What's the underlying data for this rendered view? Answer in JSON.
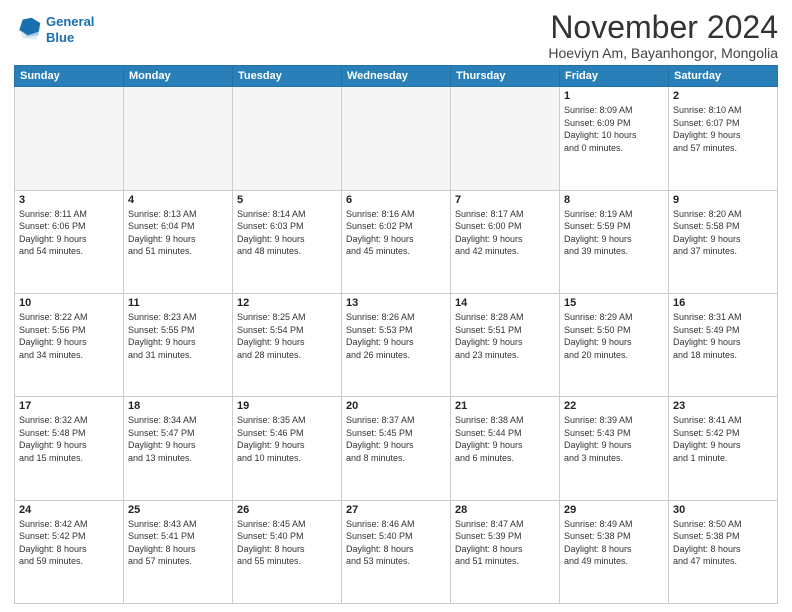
{
  "header": {
    "logo_line1": "General",
    "logo_line2": "Blue",
    "month": "November 2024",
    "location": "Hoeviyn Am, Bayanhongor, Mongolia"
  },
  "weekdays": [
    "Sunday",
    "Monday",
    "Tuesday",
    "Wednesday",
    "Thursday",
    "Friday",
    "Saturday"
  ],
  "weeks": [
    [
      {
        "day": "",
        "info": ""
      },
      {
        "day": "",
        "info": ""
      },
      {
        "day": "",
        "info": ""
      },
      {
        "day": "",
        "info": ""
      },
      {
        "day": "",
        "info": ""
      },
      {
        "day": "1",
        "info": "Sunrise: 8:09 AM\nSunset: 6:09 PM\nDaylight: 10 hours\nand 0 minutes."
      },
      {
        "day": "2",
        "info": "Sunrise: 8:10 AM\nSunset: 6:07 PM\nDaylight: 9 hours\nand 57 minutes."
      }
    ],
    [
      {
        "day": "3",
        "info": "Sunrise: 8:11 AM\nSunset: 6:06 PM\nDaylight: 9 hours\nand 54 minutes."
      },
      {
        "day": "4",
        "info": "Sunrise: 8:13 AM\nSunset: 6:04 PM\nDaylight: 9 hours\nand 51 minutes."
      },
      {
        "day": "5",
        "info": "Sunrise: 8:14 AM\nSunset: 6:03 PM\nDaylight: 9 hours\nand 48 minutes."
      },
      {
        "day": "6",
        "info": "Sunrise: 8:16 AM\nSunset: 6:02 PM\nDaylight: 9 hours\nand 45 minutes."
      },
      {
        "day": "7",
        "info": "Sunrise: 8:17 AM\nSunset: 6:00 PM\nDaylight: 9 hours\nand 42 minutes."
      },
      {
        "day": "8",
        "info": "Sunrise: 8:19 AM\nSunset: 5:59 PM\nDaylight: 9 hours\nand 39 minutes."
      },
      {
        "day": "9",
        "info": "Sunrise: 8:20 AM\nSunset: 5:58 PM\nDaylight: 9 hours\nand 37 minutes."
      }
    ],
    [
      {
        "day": "10",
        "info": "Sunrise: 8:22 AM\nSunset: 5:56 PM\nDaylight: 9 hours\nand 34 minutes."
      },
      {
        "day": "11",
        "info": "Sunrise: 8:23 AM\nSunset: 5:55 PM\nDaylight: 9 hours\nand 31 minutes."
      },
      {
        "day": "12",
        "info": "Sunrise: 8:25 AM\nSunset: 5:54 PM\nDaylight: 9 hours\nand 28 minutes."
      },
      {
        "day": "13",
        "info": "Sunrise: 8:26 AM\nSunset: 5:53 PM\nDaylight: 9 hours\nand 26 minutes."
      },
      {
        "day": "14",
        "info": "Sunrise: 8:28 AM\nSunset: 5:51 PM\nDaylight: 9 hours\nand 23 minutes."
      },
      {
        "day": "15",
        "info": "Sunrise: 8:29 AM\nSunset: 5:50 PM\nDaylight: 9 hours\nand 20 minutes."
      },
      {
        "day": "16",
        "info": "Sunrise: 8:31 AM\nSunset: 5:49 PM\nDaylight: 9 hours\nand 18 minutes."
      }
    ],
    [
      {
        "day": "17",
        "info": "Sunrise: 8:32 AM\nSunset: 5:48 PM\nDaylight: 9 hours\nand 15 minutes."
      },
      {
        "day": "18",
        "info": "Sunrise: 8:34 AM\nSunset: 5:47 PM\nDaylight: 9 hours\nand 13 minutes."
      },
      {
        "day": "19",
        "info": "Sunrise: 8:35 AM\nSunset: 5:46 PM\nDaylight: 9 hours\nand 10 minutes."
      },
      {
        "day": "20",
        "info": "Sunrise: 8:37 AM\nSunset: 5:45 PM\nDaylight: 9 hours\nand 8 minutes."
      },
      {
        "day": "21",
        "info": "Sunrise: 8:38 AM\nSunset: 5:44 PM\nDaylight: 9 hours\nand 6 minutes."
      },
      {
        "day": "22",
        "info": "Sunrise: 8:39 AM\nSunset: 5:43 PM\nDaylight: 9 hours\nand 3 minutes."
      },
      {
        "day": "23",
        "info": "Sunrise: 8:41 AM\nSunset: 5:42 PM\nDaylight: 9 hours\nand 1 minute."
      }
    ],
    [
      {
        "day": "24",
        "info": "Sunrise: 8:42 AM\nSunset: 5:42 PM\nDaylight: 8 hours\nand 59 minutes."
      },
      {
        "day": "25",
        "info": "Sunrise: 8:43 AM\nSunset: 5:41 PM\nDaylight: 8 hours\nand 57 minutes."
      },
      {
        "day": "26",
        "info": "Sunrise: 8:45 AM\nSunset: 5:40 PM\nDaylight: 8 hours\nand 55 minutes."
      },
      {
        "day": "27",
        "info": "Sunrise: 8:46 AM\nSunset: 5:40 PM\nDaylight: 8 hours\nand 53 minutes."
      },
      {
        "day": "28",
        "info": "Sunrise: 8:47 AM\nSunset: 5:39 PM\nDaylight: 8 hours\nand 51 minutes."
      },
      {
        "day": "29",
        "info": "Sunrise: 8:49 AM\nSunset: 5:38 PM\nDaylight: 8 hours\nand 49 minutes."
      },
      {
        "day": "30",
        "info": "Sunrise: 8:50 AM\nSunset: 5:38 PM\nDaylight: 8 hours\nand 47 minutes."
      }
    ]
  ]
}
